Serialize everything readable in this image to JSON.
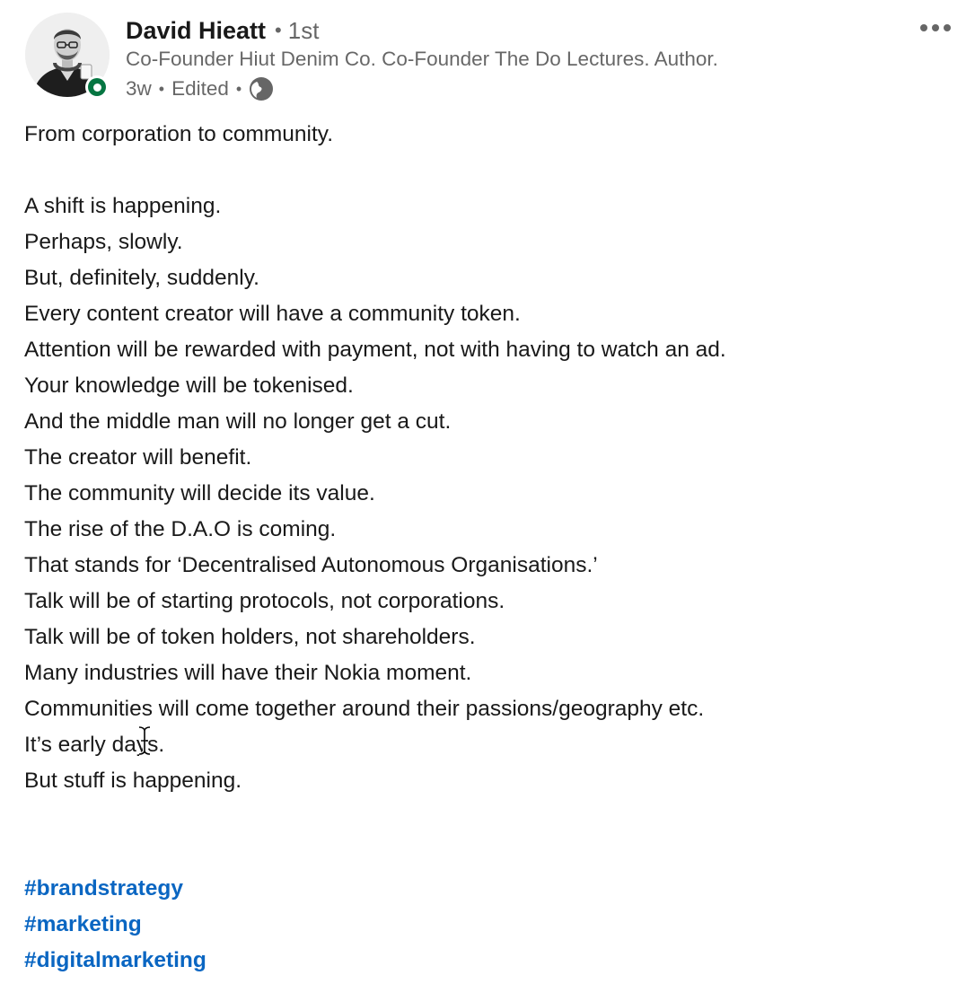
{
  "post": {
    "author": {
      "name": "David Hieatt",
      "connection_degree": "1st",
      "headline": "Co-Founder Hiut Denim Co. Co-Founder The Do Lectures. Author.",
      "presence_status_color": "#057642"
    },
    "meta": {
      "age": "3w",
      "edited": "Edited",
      "visibility_icon": "globe-icon"
    },
    "more_menu_icon": "ellipsis-icon",
    "body_lines": [
      "From corporation to community.",
      "",
      "A shift is happening.",
      "Perhaps, slowly.",
      "But, definitely, suddenly.",
      "Every content creator will have a community token.",
      "Attention will be rewarded with payment, not with having to watch an ad.",
      "Your knowledge will be tokenised.",
      "And the middle man will no longer get a cut.",
      "The creator will benefit.",
      "The community will decide its value.",
      "The rise of the D.A.O is coming.",
      "That stands for ‘Decentralised Autonomous Organisations.’",
      "Talk will be of starting protocols, not corporations.",
      "Talk will be of token holders, not shareholders.",
      "Many industries will have their Nokia moment.",
      "Communities will come together around their passions/geography etc.",
      "It’s early days.",
      "But stuff is happening."
    ],
    "hashtags": [
      "#brandstrategy",
      "#marketing",
      "#digitalmarketing"
    ]
  },
  "colors": {
    "link": "#0a66c2",
    "secondary_text": "#666666",
    "presence": "#057642"
  }
}
